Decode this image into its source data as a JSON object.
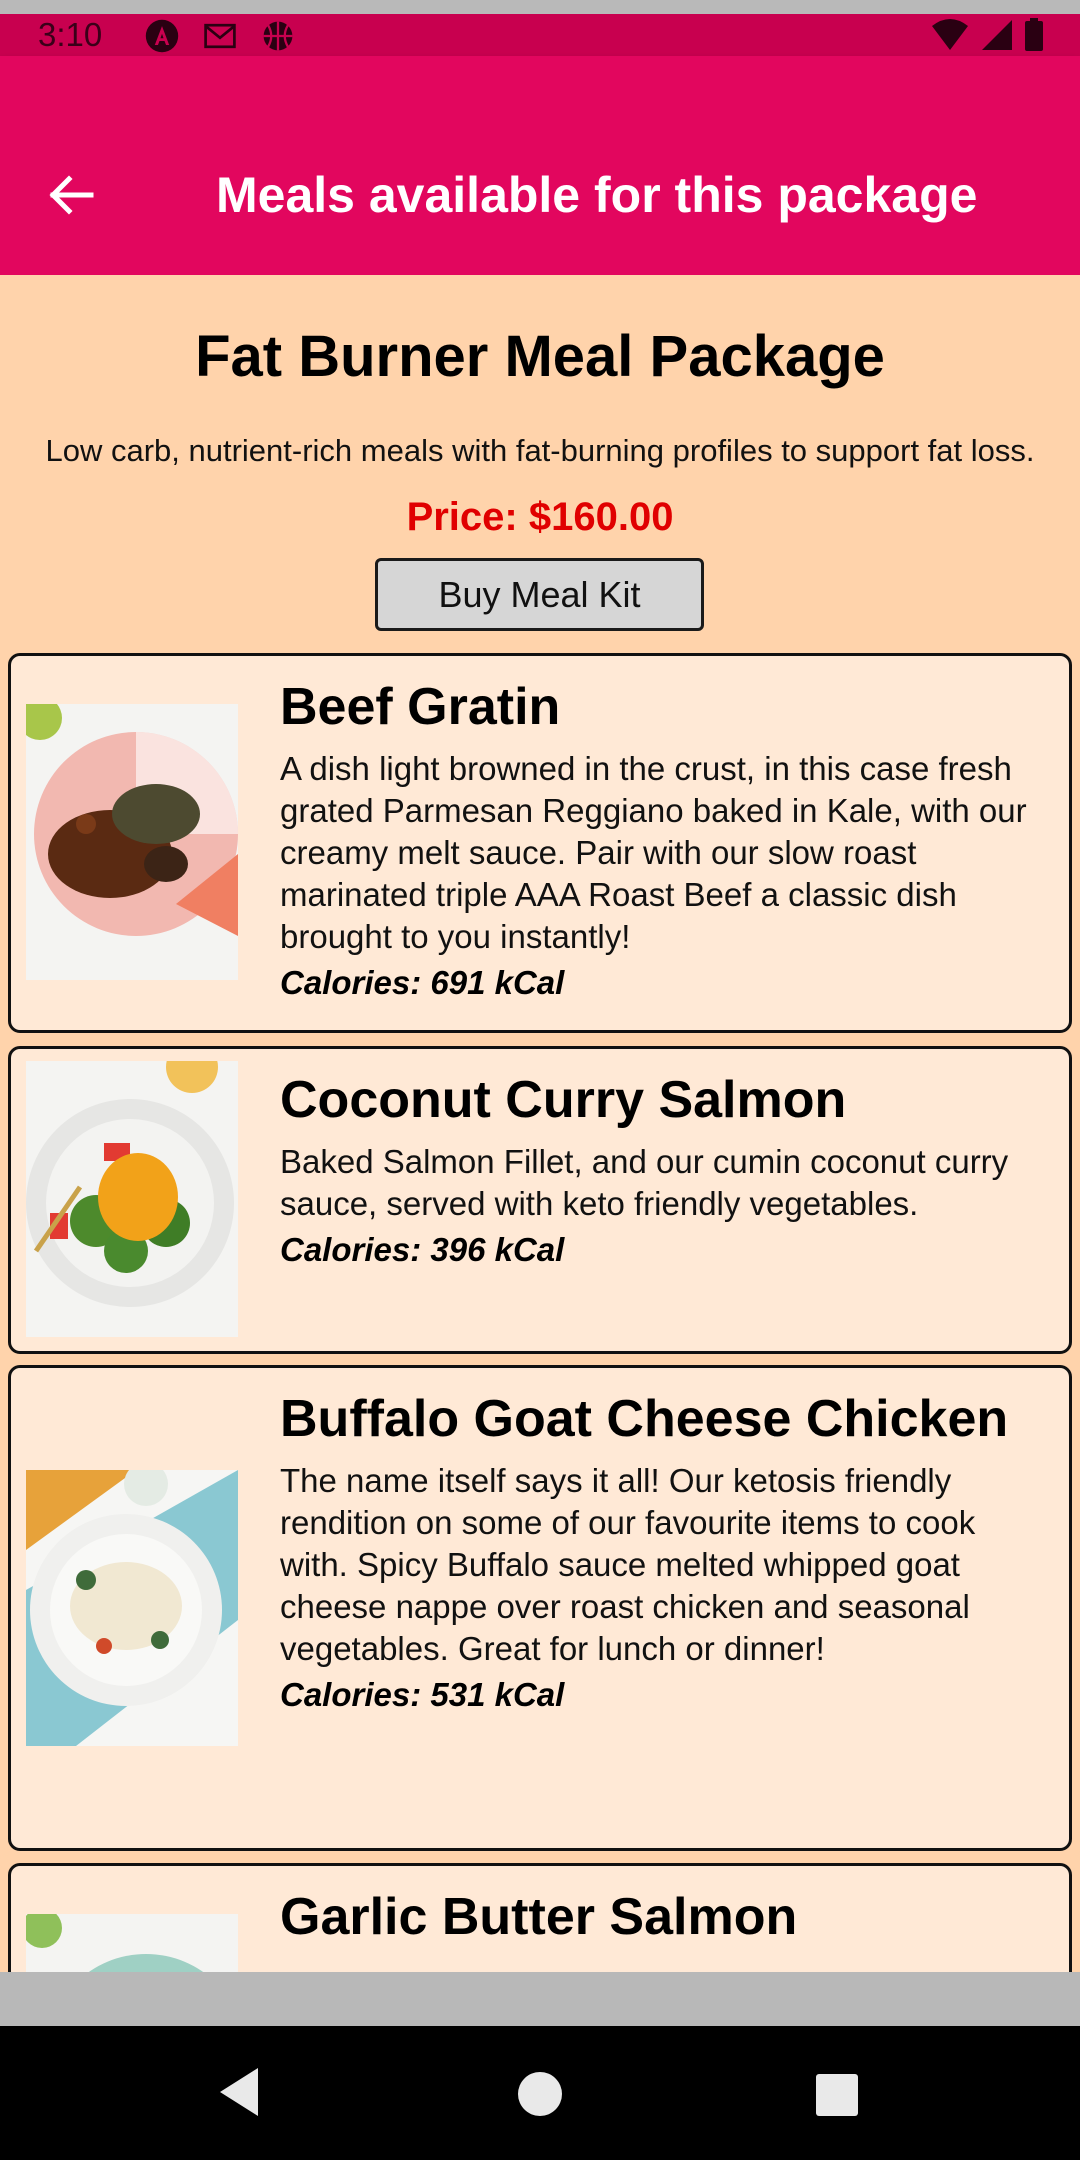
{
  "status_bar": {
    "time": "3:10",
    "notification_icons": [
      "angular-icon",
      "gmail-icon",
      "basketball-icon"
    ],
    "system_icons": [
      "wifi-icon",
      "signal-icon",
      "battery-icon"
    ]
  },
  "app_bar": {
    "back_icon": "arrow-left-icon",
    "title": "Meals available for this package"
  },
  "package": {
    "title": "Fat Burner Meal Package",
    "description": "Low carb, nutrient-rich meals with fat-burning profiles to support fat loss.",
    "price": "Price: $160.00",
    "buy_label": "Buy Meal Kit"
  },
  "meals": [
    {
      "name": "Beef Gratin",
      "description": "A dish light browned in the crust, in this case fresh grated Parmesan Reggiano baked in Kale, with our creamy melt sauce. Pair with our slow roast marinated triple AAA Roast Beef a classic dish brought to you instantly!",
      "calories": "Calories: 691 kCal"
    },
    {
      "name": "Coconut Curry Salmon",
      "description": "Baked Salmon Fillet, and our cumin coconut curry sauce, served with keto friendly vegetables.",
      "calories": "Calories: 396 kCal"
    },
    {
      "name": "Buffalo Goat Cheese Chicken",
      "description": "The name itself says it all! Our ketosis friendly rendition on some of our favourite items to cook with. Spicy Buffalo sauce melted whipped goat cheese nappe over roast chicken and seasonal vegetables. Great for lunch or dinner!",
      "calories": "Calories: 531 kCal"
    },
    {
      "name": "Garlic Butter Salmon"
    }
  ],
  "nav_bar": {
    "icons": [
      "nav-back-icon",
      "nav-home-icon",
      "nav-recents-icon"
    ]
  },
  "colors": {
    "status_bar": "#c8004f",
    "app_bar": "#e2065e",
    "background": "#ffd3ab",
    "card": "#ffe9d6",
    "price": "#e00000"
  }
}
